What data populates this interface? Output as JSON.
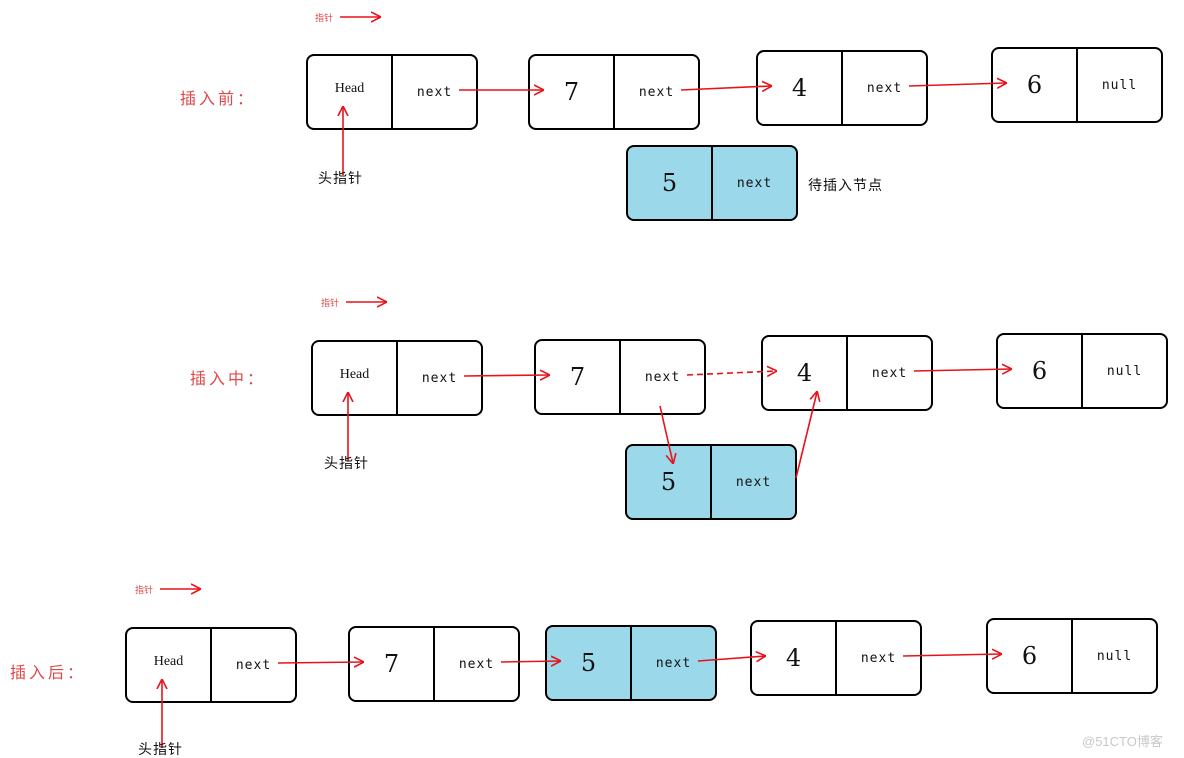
{
  "colors": {
    "arrow": "#e8131a",
    "label": "#e04848",
    "highlight_node": "#9bd8e9",
    "border": "#000000"
  },
  "legend_label": "指针",
  "head_pointer_label": "头指针",
  "pending_node_label": "待插入节点",
  "watermark": "@51CTO博客",
  "stages": [
    {
      "label": "插入前：",
      "nodes": [
        {
          "value": "Head",
          "field": "next",
          "kind": "head"
        },
        {
          "value": "7",
          "field": "next"
        },
        {
          "value": "4",
          "field": "next"
        },
        {
          "value": "6",
          "field": "null"
        }
      ],
      "pending_node": {
        "value": "5",
        "field": "next",
        "highlight": true
      }
    },
    {
      "label": "插入中：",
      "nodes": [
        {
          "value": "Head",
          "field": "next",
          "kind": "head"
        },
        {
          "value": "7",
          "field": "next"
        },
        {
          "value": "4",
          "field": "next"
        },
        {
          "value": "6",
          "field": "null"
        }
      ],
      "pending_node": {
        "value": "5",
        "field": "next",
        "highlight": true
      },
      "links_note": "7.next → 5 ; 5.next → 4 ; old 7.next → 4 dashed"
    },
    {
      "label": "插入后：",
      "nodes": [
        {
          "value": "Head",
          "field": "next",
          "kind": "head"
        },
        {
          "value": "7",
          "field": "next"
        },
        {
          "value": "5",
          "field": "next",
          "highlight": true
        },
        {
          "value": "4",
          "field": "next"
        },
        {
          "value": "6",
          "field": "null"
        }
      ]
    }
  ]
}
